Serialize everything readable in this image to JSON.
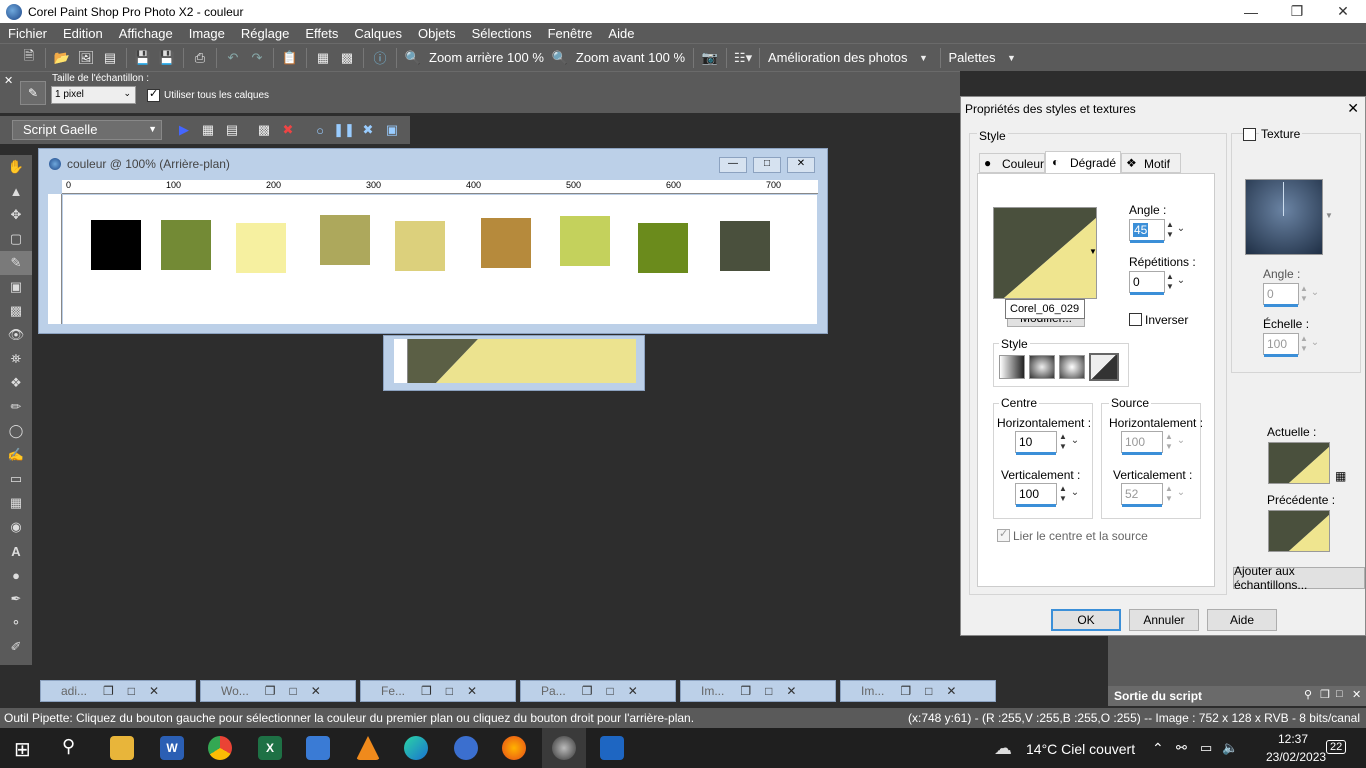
{
  "window": {
    "title": "Corel Paint Shop Pro Photo X2 - couleur"
  },
  "menu": [
    "Fichier",
    "Edition",
    "Affichage",
    "Image",
    "Réglage",
    "Effets",
    "Calques",
    "Objets",
    "Sélections",
    "Fenêtre",
    "Aide"
  ],
  "toolbar": {
    "zoom_out": "Zoom arrière 100 %",
    "zoom_in": "Zoom avant 100 %",
    "enhance": "Amélioration des photos",
    "palettes": "Palettes"
  },
  "tool_options": {
    "sample_size_label": "Taille de l'échantillon :",
    "sample_size_value": "1 pixel",
    "all_layers_label": "Utiliser tous les calques"
  },
  "script": {
    "name": "Script Gaelle"
  },
  "doc": {
    "title": "couleur @ 100% (Arrière-plan)",
    "ruler_marks": [
      "0",
      "100",
      "200",
      "300",
      "400",
      "500",
      "600",
      "700"
    ],
    "swatches": [
      {
        "color": "#000000"
      },
      {
        "color": "#738a35"
      },
      {
        "color": "#f6f0a0"
      },
      {
        "color": "#ada85c"
      },
      {
        "color": "#dcd07c"
      },
      {
        "color": "#b68a3c"
      },
      {
        "color": "#c4d15c"
      },
      {
        "color": "#6b8b1c"
      },
      {
        "color": "#4a503d"
      }
    ]
  },
  "dialog": {
    "title": "Propriétés des styles et textures",
    "style_label": "Style",
    "tabs": [
      "Couleur",
      "Dégradé",
      "Motif"
    ],
    "angle_label": "Angle :",
    "angle_value": "45",
    "repeats_label": "Répétitions :",
    "repeats_value": "0",
    "gradient_name": "Corel_06_029",
    "edit_button": "Modifier...",
    "invert_label": "Inverser",
    "style_group": "Style",
    "center_group": "Centre",
    "source_group": "Source",
    "center_h_label": "Horizontalement :",
    "center_h_value": "10",
    "center_v_label": "Verticalement :",
    "center_v_value": "100",
    "source_h_label": "Horizontalement :",
    "source_h_value": "100",
    "source_v_label": "Verticalement :",
    "source_v_value": "52",
    "link_label": "Lier le centre et la source",
    "texture_label": "Texture",
    "tex_angle_label": "Angle :",
    "tex_angle_value": "0",
    "tex_scale_label": "Échelle :",
    "tex_scale_value": "100",
    "current_label": "Actuelle :",
    "previous_label": "Précédente :",
    "add_swatch_button": "Ajouter aux échantillons...",
    "ok": "OK",
    "cancel": "Annuler",
    "help": "Aide",
    "gradient_colors": {
      "dark": "#4a503d",
      "light": "#efe58f"
    }
  },
  "script_output": {
    "title": "Sortie du script"
  },
  "minimized": [
    {
      "label": "adi..."
    },
    {
      "label": "Wo..."
    },
    {
      "label": "Fe..."
    },
    {
      "label": "Pa..."
    },
    {
      "label": "Im..."
    },
    {
      "label": "Im..."
    }
  ],
  "status": {
    "left": "Outil Pipette: Cliquez du bouton gauche pour sélectionner la couleur du premier plan ou cliquez du bouton droit pour l'arrière-plan.",
    "right": "(x:748 y:61) - (R :255,V :255,B :255,O :255) -- Image : 752 x 128 x RVB - 8 bits/canal"
  },
  "taskbar": {
    "weather": "14°C  Ciel couvert",
    "time": "12:37",
    "date": "23/02/2023",
    "notifications": "22"
  }
}
